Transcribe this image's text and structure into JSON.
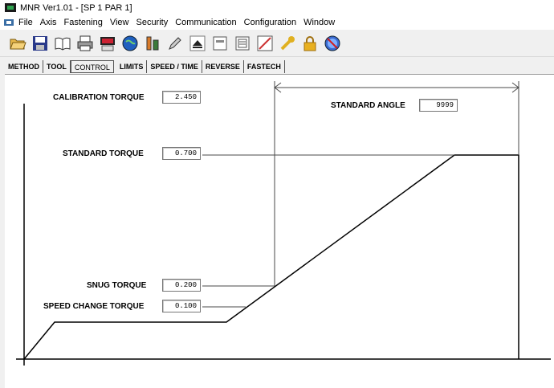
{
  "window": {
    "title": "MNR Ver1.01 - [SP 1 PAR 1]"
  },
  "menu": {
    "items": [
      "File",
      "Axis",
      "Fastening",
      "View",
      "Security",
      "Communication",
      "Configuration",
      "Window"
    ]
  },
  "toolbar": {
    "icons": [
      "open-folder-icon",
      "save-icon",
      "book-icon",
      "print-icon",
      "meter-icon",
      "globe-icon",
      "tool-icon",
      "pen-icon",
      "eject-icon",
      "display-icon",
      "document-icon",
      "graph-icon",
      "wrench-icon",
      "lock-icon",
      "audio-off-icon"
    ]
  },
  "tabs": [
    {
      "label": "METHOD",
      "active": false
    },
    {
      "label": "TOOL",
      "active": false
    },
    {
      "label": "CONTROL",
      "active": true
    },
    {
      "label": "LIMITS",
      "active": false
    },
    {
      "label": "SPEED / TIME",
      "active": false
    },
    {
      "label": "REVERSE",
      "active": false
    },
    {
      "label": "FASTECH",
      "active": false
    }
  ],
  "control": {
    "calibration_torque": {
      "label": "CALIBRATION TORQUE",
      "value": "2.450"
    },
    "standard_torque": {
      "label": "STANDARD TORQUE",
      "value": "0.700"
    },
    "snug_torque": {
      "label": "SNUG TORQUE",
      "value": "0.200"
    },
    "speed_change_torque": {
      "label": "SPEED CHANGE TORQUE",
      "value": "0.100"
    },
    "standard_angle": {
      "label": "STANDARD ANGLE",
      "value": "9999"
    }
  },
  "colors": {
    "line": "#000000",
    "guide": "#4a4a4a"
  }
}
